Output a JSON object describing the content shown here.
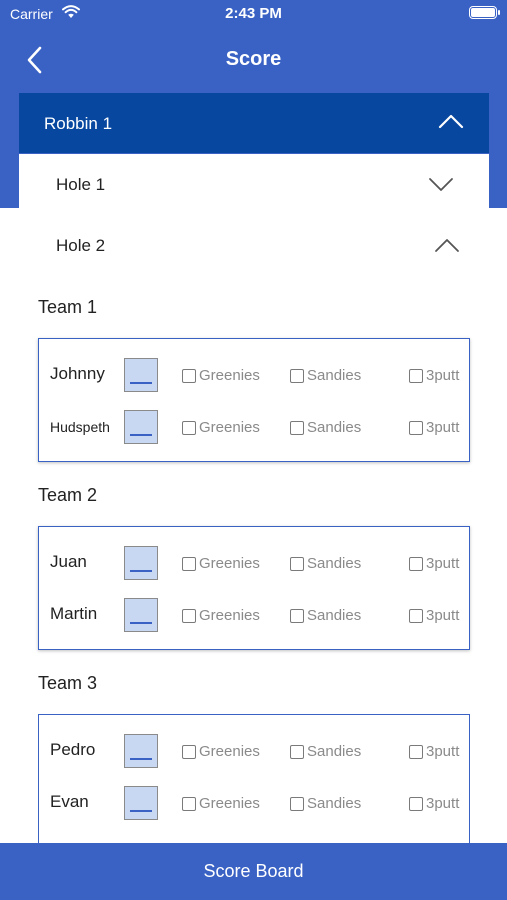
{
  "status": {
    "carrier": "Carrier",
    "time": "2:43 PM"
  },
  "nav": {
    "title": "Score",
    "back_icon": "chevron-left-icon"
  },
  "round": {
    "title": "Robbin 1",
    "expanded": true
  },
  "holes": [
    {
      "label": "Hole 1",
      "expanded": false
    },
    {
      "label": "Hole 2",
      "expanded": true
    }
  ],
  "checkbox_labels": {
    "greenies": "Greenies",
    "sandies": "Sandies",
    "threeputt": "3putt"
  },
  "teams": [
    {
      "name": "Team 1",
      "players": [
        {
          "name": "Johnny"
        },
        {
          "name": "Hudspeth"
        }
      ]
    },
    {
      "name": "Team 2",
      "players": [
        {
          "name": "Juan"
        },
        {
          "name": "Martin"
        }
      ]
    },
    {
      "name": "Team 3",
      "players": [
        {
          "name": "Pedro"
        },
        {
          "name": "Evan"
        }
      ]
    }
  ],
  "bottom": {
    "label": "Score Board"
  },
  "colors": {
    "primary": "#3a62c4",
    "round_header": "#0747a0",
    "score_box": "#c9d8f2"
  }
}
